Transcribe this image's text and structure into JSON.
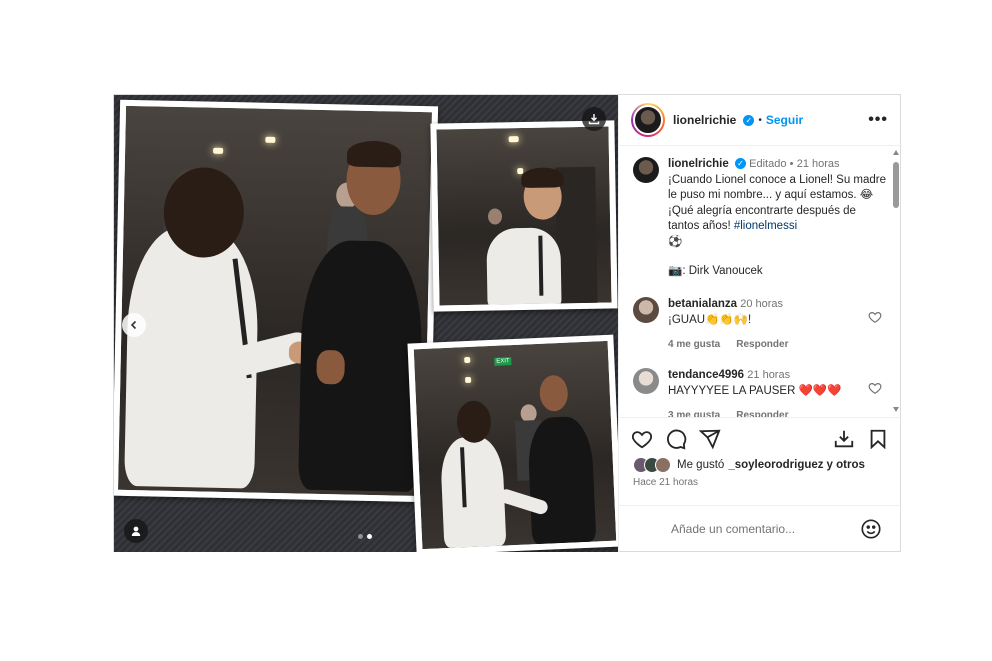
{
  "post": {
    "header": {
      "username": "lionelrichie",
      "separator": "•",
      "follow_label": "Seguir",
      "more_label": "•••"
    },
    "caption": {
      "username": "lionelrichie",
      "edited": "Editado",
      "separator": "•",
      "time": "21 horas",
      "text_1": "¡Cuando Lionel conoce a Lionel! Su madre le puso mi nombre... y aquí estamos. 😂 ¡Qué alegría encontrarte después de tantos años!",
      "hashtag": "#lionelmessi",
      "text_2": "⚽",
      "credit": "📷: Dirk Vanoucek"
    },
    "comments": [
      {
        "username": "betanialanza",
        "time": "20 horas",
        "text": "¡GUAU👏👏🙌!",
        "likes": "4 me gusta",
        "reply": "Responder"
      },
      {
        "username": "tendance4996",
        "time": "21 horas",
        "text": "HAYYYYEE LA PAUSER ❤️❤️❤️",
        "likes": "3 me gusta",
        "reply": "Responder"
      }
    ],
    "likes_line": {
      "prefix": "Me gustó",
      "user": "_soyleorodriguez",
      "suffix": "y otros"
    },
    "timestamp": "Hace 21 horas",
    "add_comment_placeholder": "Añade un comentario...",
    "media": {
      "exit_sign": "EXIT",
      "carousel_index": 2,
      "carousel_total": 2
    },
    "icons": {
      "download": "download-icon",
      "prev": "chevron-left-icon",
      "tag": "user-tag-icon",
      "heart": "heart-icon",
      "comment": "comment-icon",
      "share": "share-icon",
      "save": "bookmark-icon",
      "emoji": "emoji-icon"
    },
    "colors": {
      "accent": "#0095f6",
      "link": "#00376b",
      "muted": "#737373"
    }
  }
}
